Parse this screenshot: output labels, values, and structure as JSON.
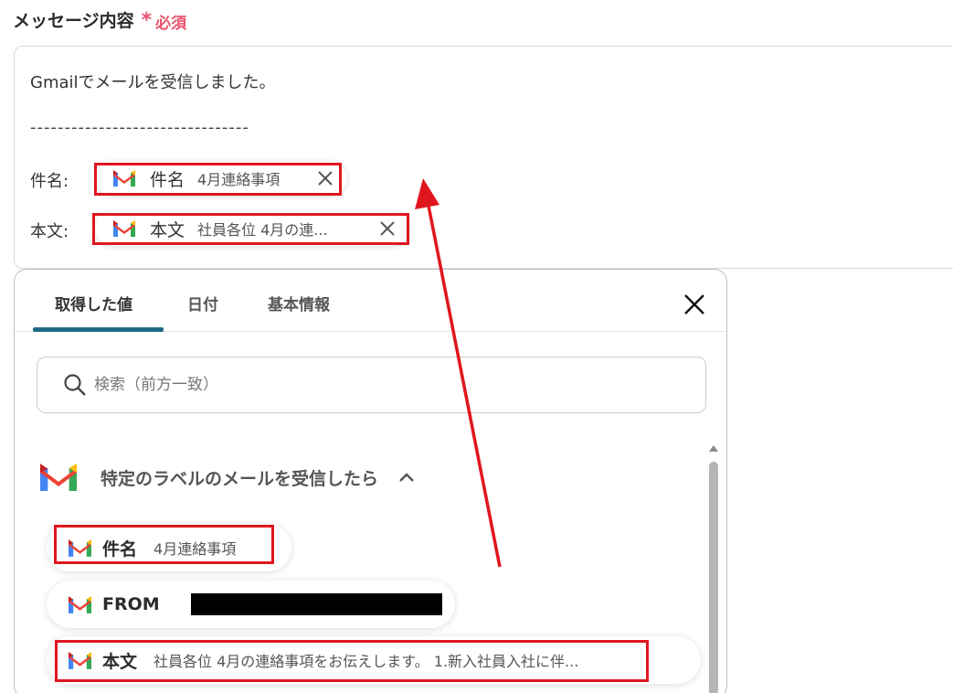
{
  "field": {
    "label": "メッセージ内容",
    "required_mark": "*",
    "required_text": "必須"
  },
  "editor": {
    "line1": "Gmailでメールを受信しました。",
    "separator": "--------------------------------",
    "subject_label": "件名:",
    "body_label": "本文:",
    "chips": [
      {
        "name": "件名",
        "value": "4月連絡事項"
      },
      {
        "name": "本文",
        "value": "社員各位 4月の連..."
      }
    ]
  },
  "panel": {
    "tabs": [
      {
        "label": "取得した値",
        "active": true
      },
      {
        "label": "日付",
        "active": false
      },
      {
        "label": "基本情報",
        "active": false
      }
    ],
    "search_placeholder": "検索（前方一致）",
    "group_title": "特定のラベルのメールを受信したら",
    "items": [
      {
        "name": "件名",
        "value": "4月連絡事項"
      },
      {
        "name": "FROM",
        "value": ""
      },
      {
        "name": "本文",
        "value": "社員各位 4月の連絡事項をお伝えします。 1.新入社員入社に伴..."
      }
    ]
  },
  "colors": {
    "accent_tab": "#1e6a85",
    "required": "#e8536b",
    "highlight": "#e0161f"
  },
  "icons": [
    "gmail-icon",
    "close-icon",
    "search-icon",
    "chevron-up-icon",
    "scroll-up-icon"
  ]
}
